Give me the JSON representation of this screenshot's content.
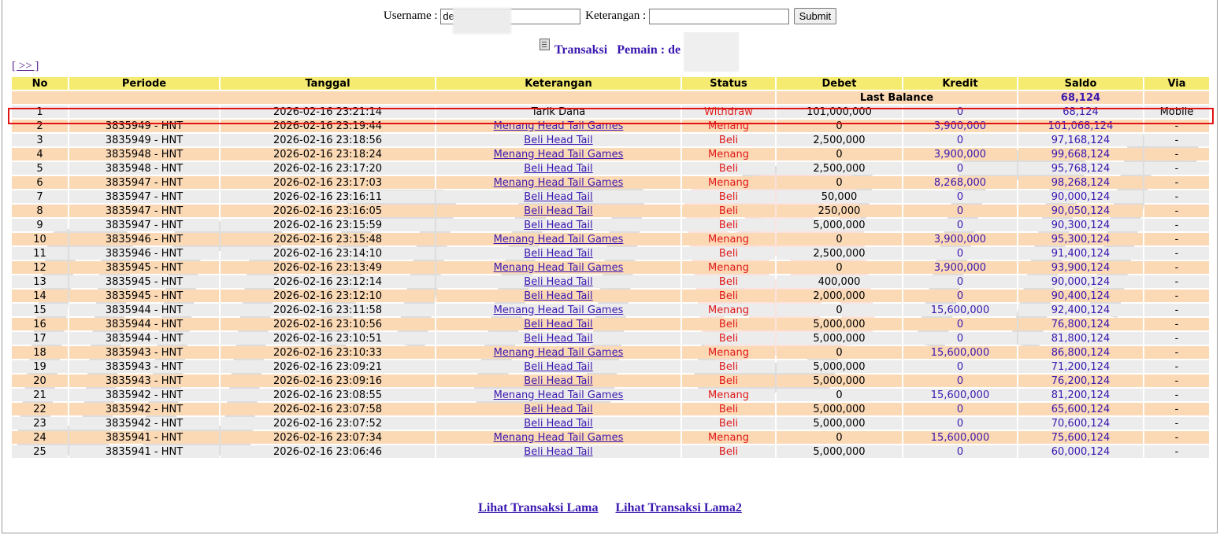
{
  "form": {
    "username_label": "Username :",
    "username_value": "de",
    "keterangan_label": "Keterangan :",
    "keterangan_value": "",
    "submit_label": "Submit"
  },
  "title": {
    "transaksi": "Transaksi",
    "pemain": "Pemain : de"
  },
  "nav_more": "[ >> ]",
  "table": {
    "headers": [
      "No",
      "Periode",
      "Tanggal",
      "Keterangan",
      "Status",
      "Debet",
      "Kredit",
      "Saldo",
      "Via"
    ],
    "last_balance_label": "Last Balance",
    "last_balance_value": "68,124",
    "rows": [
      {
        "no": "1",
        "periode": "",
        "tanggal": "2026-02-16 23:21:14",
        "keterangan": "Tarik Dana",
        "link": false,
        "status": "Withdraw",
        "debet": "101,000,000",
        "kredit": "0",
        "saldo": "68,124",
        "via": "Mobile"
      },
      {
        "no": "2",
        "periode": "3835949 - HNT",
        "tanggal": "2026-02-16 23:19:44",
        "keterangan": "Menang Head Tail Games",
        "link": true,
        "status": "Menang",
        "debet": "0",
        "kredit": "3,900,000",
        "saldo": "101,068,124",
        "via": "-"
      },
      {
        "no": "3",
        "periode": "3835949 - HNT",
        "tanggal": "2026-02-16 23:18:56",
        "keterangan": "Beli Head Tail",
        "link": true,
        "status": "Beli",
        "debet": "2,500,000",
        "kredit": "0",
        "saldo": "97,168,124",
        "via": "-"
      },
      {
        "no": "4",
        "periode": "3835948 - HNT",
        "tanggal": "2026-02-16 23:18:24",
        "keterangan": "Menang Head Tail Games",
        "link": true,
        "status": "Menang",
        "debet": "0",
        "kredit": "3,900,000",
        "saldo": "99,668,124",
        "via": "-"
      },
      {
        "no": "5",
        "periode": "3835948 - HNT",
        "tanggal": "2026-02-16 23:17:20",
        "keterangan": "Beli Head Tail",
        "link": true,
        "status": "Beli",
        "debet": "2,500,000",
        "kredit": "0",
        "saldo": "95,768,124",
        "via": "-"
      },
      {
        "no": "6",
        "periode": "3835947 - HNT",
        "tanggal": "2026-02-16 23:17:03",
        "keterangan": "Menang Head Tail Games",
        "link": true,
        "status": "Menang",
        "debet": "0",
        "kredit": "8,268,000",
        "saldo": "98,268,124",
        "via": "-"
      },
      {
        "no": "7",
        "periode": "3835947 - HNT",
        "tanggal": "2026-02-16 23:16:11",
        "keterangan": "Beli Head Tail",
        "link": true,
        "status": "Beli",
        "debet": "50,000",
        "kredit": "0",
        "saldo": "90,000,124",
        "via": "-"
      },
      {
        "no": "8",
        "periode": "3835947 - HNT",
        "tanggal": "2026-02-16 23:16:05",
        "keterangan": "Beli Head Tail",
        "link": true,
        "status": "Beli",
        "debet": "250,000",
        "kredit": "0",
        "saldo": "90,050,124",
        "via": "-"
      },
      {
        "no": "9",
        "periode": "3835947 - HNT",
        "tanggal": "2026-02-16 23:15:59",
        "keterangan": "Beli Head Tail",
        "link": true,
        "status": "Beli",
        "debet": "5,000,000",
        "kredit": "0",
        "saldo": "90,300,124",
        "via": "-"
      },
      {
        "no": "10",
        "periode": "3835946 - HNT",
        "tanggal": "2026-02-16 23:15:48",
        "keterangan": "Menang Head Tail Games",
        "link": true,
        "status": "Menang",
        "debet": "0",
        "kredit": "3,900,000",
        "saldo": "95,300,124",
        "via": "-"
      },
      {
        "no": "11",
        "periode": "3835946 - HNT",
        "tanggal": "2026-02-16 23:14:10",
        "keterangan": "Beli Head Tail",
        "link": true,
        "status": "Beli",
        "debet": "2,500,000",
        "kredit": "0",
        "saldo": "91,400,124",
        "via": "-"
      },
      {
        "no": "12",
        "periode": "3835945 - HNT",
        "tanggal": "2026-02-16 23:13:49",
        "keterangan": "Menang Head Tail Games",
        "link": true,
        "status": "Menang",
        "debet": "0",
        "kredit": "3,900,000",
        "saldo": "93,900,124",
        "via": "-"
      },
      {
        "no": "13",
        "periode": "3835945 - HNT",
        "tanggal": "2026-02-16 23:12:14",
        "keterangan": "Beli Head Tail",
        "link": true,
        "status": "Beli",
        "debet": "400,000",
        "kredit": "0",
        "saldo": "90,000,124",
        "via": "-"
      },
      {
        "no": "14",
        "periode": "3835945 - HNT",
        "tanggal": "2026-02-16 23:12:10",
        "keterangan": "Beli Head Tail",
        "link": true,
        "status": "Beli",
        "debet": "2,000,000",
        "kredit": "0",
        "saldo": "90,400,124",
        "via": "-"
      },
      {
        "no": "15",
        "periode": "3835944 - HNT",
        "tanggal": "2026-02-16 23:11:58",
        "keterangan": "Menang Head Tail Games",
        "link": true,
        "status": "Menang",
        "debet": "0",
        "kredit": "15,600,000",
        "saldo": "92,400,124",
        "via": "-"
      },
      {
        "no": "16",
        "periode": "3835944 - HNT",
        "tanggal": "2026-02-16 23:10:56",
        "keterangan": "Beli Head Tail",
        "link": true,
        "status": "Beli",
        "debet": "5,000,000",
        "kredit": "0",
        "saldo": "76,800,124",
        "via": "-"
      },
      {
        "no": "17",
        "periode": "3835944 - HNT",
        "tanggal": "2026-02-16 23:10:51",
        "keterangan": "Beli Head Tail",
        "link": true,
        "status": "Beli",
        "debet": "5,000,000",
        "kredit": "0",
        "saldo": "81,800,124",
        "via": "-"
      },
      {
        "no": "18",
        "periode": "3835943 - HNT",
        "tanggal": "2026-02-16 23:10:33",
        "keterangan": "Menang Head Tail Games",
        "link": true,
        "status": "Menang",
        "debet": "0",
        "kredit": "15,600,000",
        "saldo": "86,800,124",
        "via": "-"
      },
      {
        "no": "19",
        "periode": "3835943 - HNT",
        "tanggal": "2026-02-16 23:09:21",
        "keterangan": "Beli Head Tail",
        "link": true,
        "status": "Beli",
        "debet": "5,000,000",
        "kredit": "0",
        "saldo": "71,200,124",
        "via": "-"
      },
      {
        "no": "20",
        "periode": "3835943 - HNT",
        "tanggal": "2026-02-16 23:09:16",
        "keterangan": "Beli Head Tail",
        "link": true,
        "status": "Beli",
        "debet": "5,000,000",
        "kredit": "0",
        "saldo": "76,200,124",
        "via": "-"
      },
      {
        "no": "21",
        "periode": "3835942 - HNT",
        "tanggal": "2026-02-16 23:08:55",
        "keterangan": "Menang Head Tail Games",
        "link": true,
        "status": "Menang",
        "debet": "0",
        "kredit": "15,600,000",
        "saldo": "81,200,124",
        "via": "-"
      },
      {
        "no": "22",
        "periode": "3835942 - HNT",
        "tanggal": "2026-02-16 23:07:58",
        "keterangan": "Beli Head Tail",
        "link": true,
        "status": "Beli",
        "debet": "5,000,000",
        "kredit": "0",
        "saldo": "65,600,124",
        "via": "-"
      },
      {
        "no": "23",
        "periode": "3835942 - HNT",
        "tanggal": "2026-02-16 23:07:52",
        "keterangan": "Beli Head Tail",
        "link": true,
        "status": "Beli",
        "debet": "5,000,000",
        "kredit": "0",
        "saldo": "70,600,124",
        "via": "-"
      },
      {
        "no": "24",
        "periode": "3835941 - HNT",
        "tanggal": "2026-02-16 23:07:34",
        "keterangan": "Menang Head Tail Games",
        "link": true,
        "status": "Menang",
        "debet": "0",
        "kredit": "15,600,000",
        "saldo": "75,600,124",
        "via": "-"
      },
      {
        "no": "25",
        "periode": "3835941 - HNT",
        "tanggal": "2026-02-16 23:06:46",
        "keterangan": "Beli Head Tail",
        "link": true,
        "status": "Beli",
        "debet": "5,000,000",
        "kredit": "0",
        "saldo": "60,000,124",
        "via": "-"
      }
    ]
  },
  "footer": {
    "link1": "Lihat Transaksi Lama",
    "link2": "Lihat Transaksi Lama2"
  },
  "colors": {
    "header_bg": "#f5eb70",
    "row_odd": "#ececec",
    "row_even": "#fbd9b5",
    "status_red": "#e01818",
    "link_purple": "#3a18b0",
    "highlight_border": "#e21414"
  }
}
